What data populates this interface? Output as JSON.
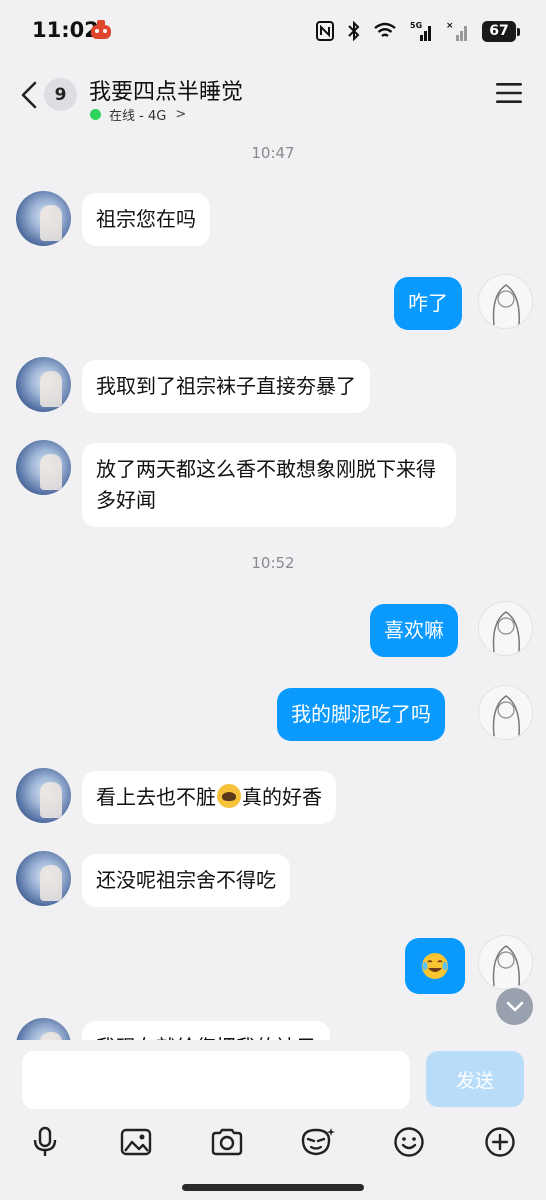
{
  "status_bar": {
    "time": "11:02",
    "battery": "67",
    "signal_label": "5G"
  },
  "header": {
    "back_badge": "9",
    "title": "我要四点半睡觉",
    "presence": "在线 - 4G",
    "presence_chevron": ">"
  },
  "messages": [
    {
      "type": "time",
      "text": "10:47"
    },
    {
      "type": "in",
      "text": "祖宗您在吗"
    },
    {
      "type": "out",
      "text": "咋了"
    },
    {
      "type": "in",
      "text": "我取到了祖宗袜子直接夯暴了"
    },
    {
      "type": "in",
      "text": "放了两天都这么香不敢想象刚脱下来得多好闻"
    },
    {
      "type": "time",
      "text": "10:52"
    },
    {
      "type": "out",
      "text": "喜欢嘛"
    },
    {
      "type": "out",
      "text": "我的脚泥吃了吗"
    },
    {
      "type": "in",
      "text_before": "看上去也不脏",
      "emoji": "astonished-face",
      "text_after": "真的好香"
    },
    {
      "type": "in",
      "text": "还没呢祖宗舍不得吃"
    },
    {
      "type": "out",
      "emoji": "laughing-tears"
    },
    {
      "type": "in",
      "text": "我现在就给您把我的袜子"
    }
  ],
  "input": {
    "placeholder": "",
    "value": "",
    "send_label": "发送"
  },
  "toolbar": [
    "microphone-icon",
    "image-icon",
    "camera-icon",
    "sticker-icon",
    "emoji-icon",
    "plus-icon"
  ],
  "colors": {
    "accent": "#0a99ff",
    "background": "#f1f1f3",
    "bubble_in": "#ffffff",
    "online": "#2fd35d",
    "send_disabled": "#b9dcf9"
  }
}
